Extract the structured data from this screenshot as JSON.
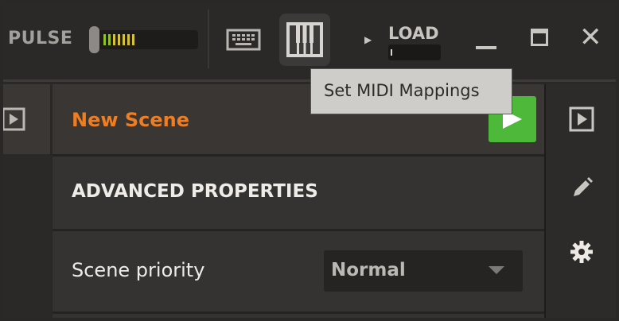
{
  "topbar": {
    "pulse_label": "PULSE",
    "load_label": "LOAD"
  },
  "tooltip": {
    "text": "Set MIDI Mappings"
  },
  "scene": {
    "title": "New Scene"
  },
  "advanced": {
    "heading": "ADVANCED PROPERTIES"
  },
  "priority": {
    "label": "Scene priority",
    "value": "Normal"
  },
  "colors": {
    "accent_orange": "#ef7d22",
    "play_green": "#4db83a"
  }
}
